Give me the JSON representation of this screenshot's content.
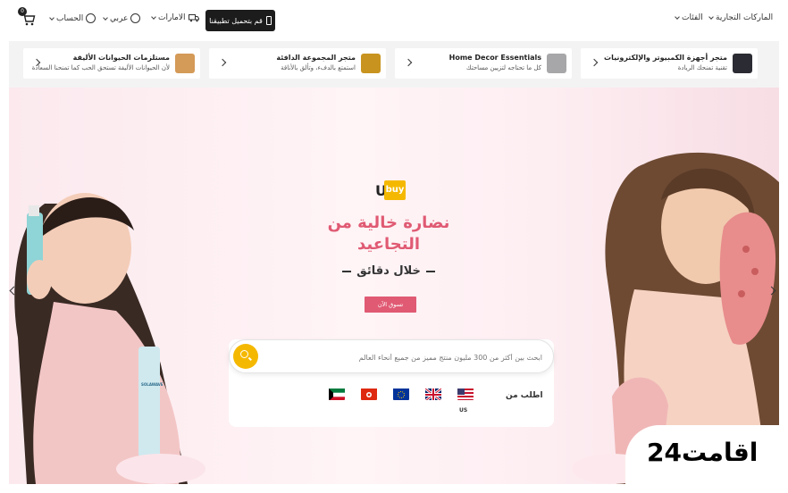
{
  "header": {
    "cart_count": "0",
    "account_label": "الحساب",
    "language_label": "عربي",
    "region_label": "الامارات",
    "app_button_label": "قم بتحميل تطبيقنا",
    "categories_label": "الفئات",
    "brands_label": "الماركات التجارية"
  },
  "stores": [
    {
      "title": "متجر أجهزة الكمبيوتر والإلكترونيات",
      "subtitle": "تقنية تمنحك الريادة",
      "icon": "computer-tower-icon"
    },
    {
      "title": "Home Decor Essentials",
      "subtitle": "كل ما تحتاجه لتزيين مساحتك",
      "icon": "home-decor-icon"
    },
    {
      "title": "متجر المجموعة الدافئة",
      "subtitle": "استمتع بالدفء، وتألق بالأناقة",
      "icon": "winter-coat-icon"
    },
    {
      "title": "مستلزمات الحيوانات الأليفة",
      "subtitle": "لأن الحيوانات الأليفة تستحق الحب كما تمنحنا السعادة",
      "icon": "pet-icon"
    }
  ],
  "hero": {
    "logo_u": "U",
    "logo_box": "buy",
    "headline": "نضارة خالية من التجاعيد",
    "subline": "خلال دقائق",
    "cta_label": "تسوق الآن",
    "product_label": "SOLAWAVE"
  },
  "search": {
    "placeholder": "ابحث بين أكثر من 300 مليون منتج مميز من جميع أنحاء العالم",
    "order_from_label": "اطلب من",
    "selected_country": "US",
    "flags": [
      "us-flag",
      "uk-flag",
      "eu-flag",
      "hongkong-flag",
      "kuwait-flag"
    ]
  },
  "watermark": {
    "text": "اقامت24"
  },
  "colors": {
    "accent_pink": "#e05a73",
    "brand_yellow": "#f5b800",
    "dark": "#1c1c1c"
  }
}
